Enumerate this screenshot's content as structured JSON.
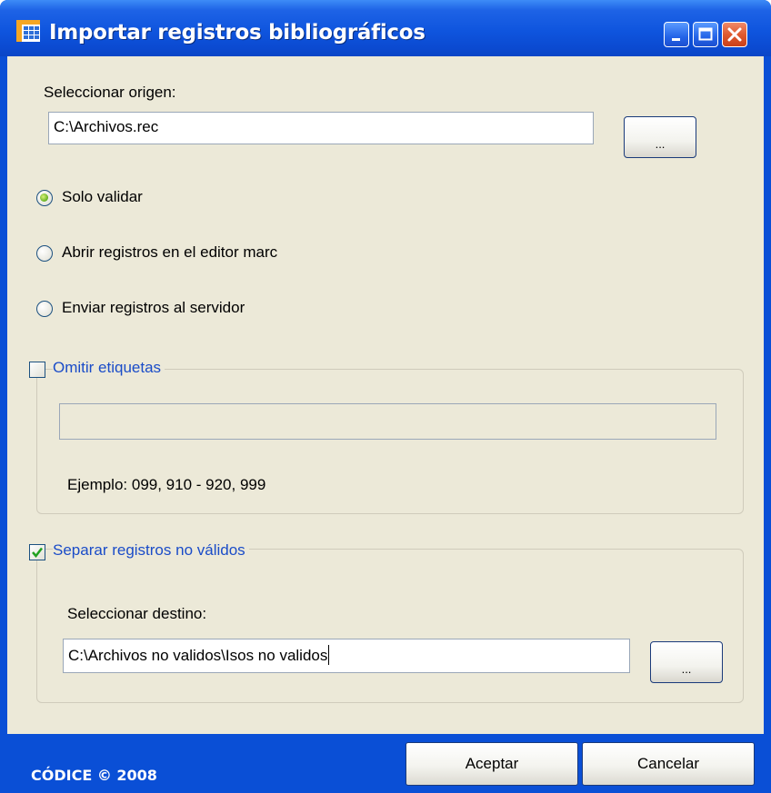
{
  "window": {
    "title": "Importar registros bibliográficos",
    "minimize_icon": "minimize-icon",
    "maximize_icon": "maximize-icon",
    "close_icon": "close-icon"
  },
  "origin": {
    "label": "Seleccionar origen:",
    "value": "C:\\Archivos.rec",
    "browse_label": "..."
  },
  "mode": {
    "selected": "Solo validar",
    "options": [
      "Solo validar",
      "Abrir registros en el editor marc",
      "Enviar registros al servidor"
    ]
  },
  "omit_tags": {
    "label": "Omitir etiquetas",
    "checked": false,
    "value": "",
    "example": "Ejemplo: 099, 910 - 920, 999"
  },
  "separate_invalid": {
    "label": "Separar registros no válidos",
    "checked": true,
    "dest_label": "Seleccionar destino:",
    "dest_value": "C:\\Archivos no validos\\Isos no validos",
    "browse_label": "..."
  },
  "footer": {
    "copyright": "CÓDICE © 2008",
    "accept_label": "Aceptar",
    "cancel_label": "Cancelar"
  },
  "colors": {
    "titlebar": "#0f55de",
    "client_bg": "#ece9d8",
    "group_title": "#1a4cc8",
    "radio_selected": "#63b020"
  }
}
